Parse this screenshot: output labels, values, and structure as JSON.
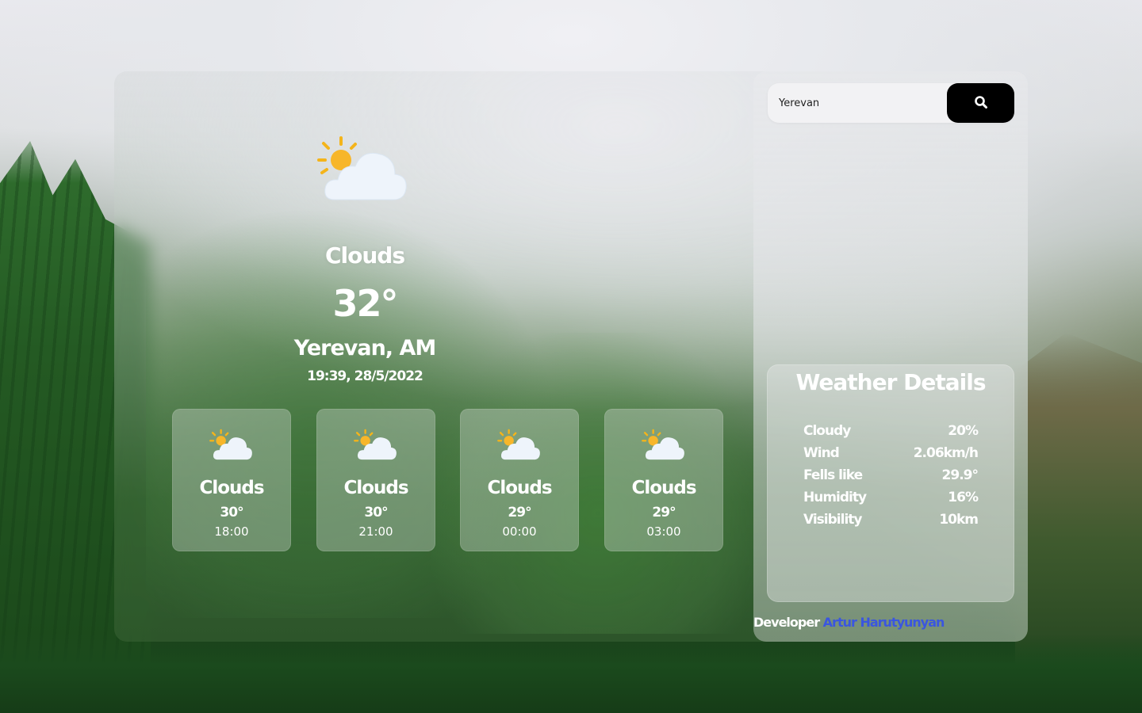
{
  "colors": {
    "accent_link": "#3a56e0",
    "button_bg": "#000000",
    "text": "#ffffff"
  },
  "search": {
    "value": "Yerevan",
    "icon": "search-icon"
  },
  "current": {
    "icon": "partly-cloudy-icon",
    "condition": "Clouds",
    "temperature": "32°",
    "city": "Yerevan, AM",
    "datetime": "19:39, 28/5/2022"
  },
  "forecast": [
    {
      "icon": "partly-cloudy-icon",
      "condition": "Clouds",
      "temp": "30°",
      "time": "18:00"
    },
    {
      "icon": "partly-cloudy-icon",
      "condition": "Clouds",
      "temp": "30°",
      "time": "21:00"
    },
    {
      "icon": "partly-cloudy-icon",
      "condition": "Clouds",
      "temp": "29°",
      "time": "00:00"
    },
    {
      "icon": "partly-cloudy-icon",
      "condition": "Clouds",
      "temp": "29°",
      "time": "03:00"
    }
  ],
  "details": {
    "title": "Weather Details",
    "rows": [
      {
        "label": "Cloudy",
        "value": "20%"
      },
      {
        "label": "Wind",
        "value": "2.06km/h"
      },
      {
        "label": "Fells like",
        "value": "29.9°"
      },
      {
        "label": "Humidity",
        "value": "16%"
      },
      {
        "label": "Visibility",
        "value": "10km"
      }
    ]
  },
  "footer": {
    "developer_label": "Developer",
    "developer_name": "Artur Harutyunyan"
  }
}
